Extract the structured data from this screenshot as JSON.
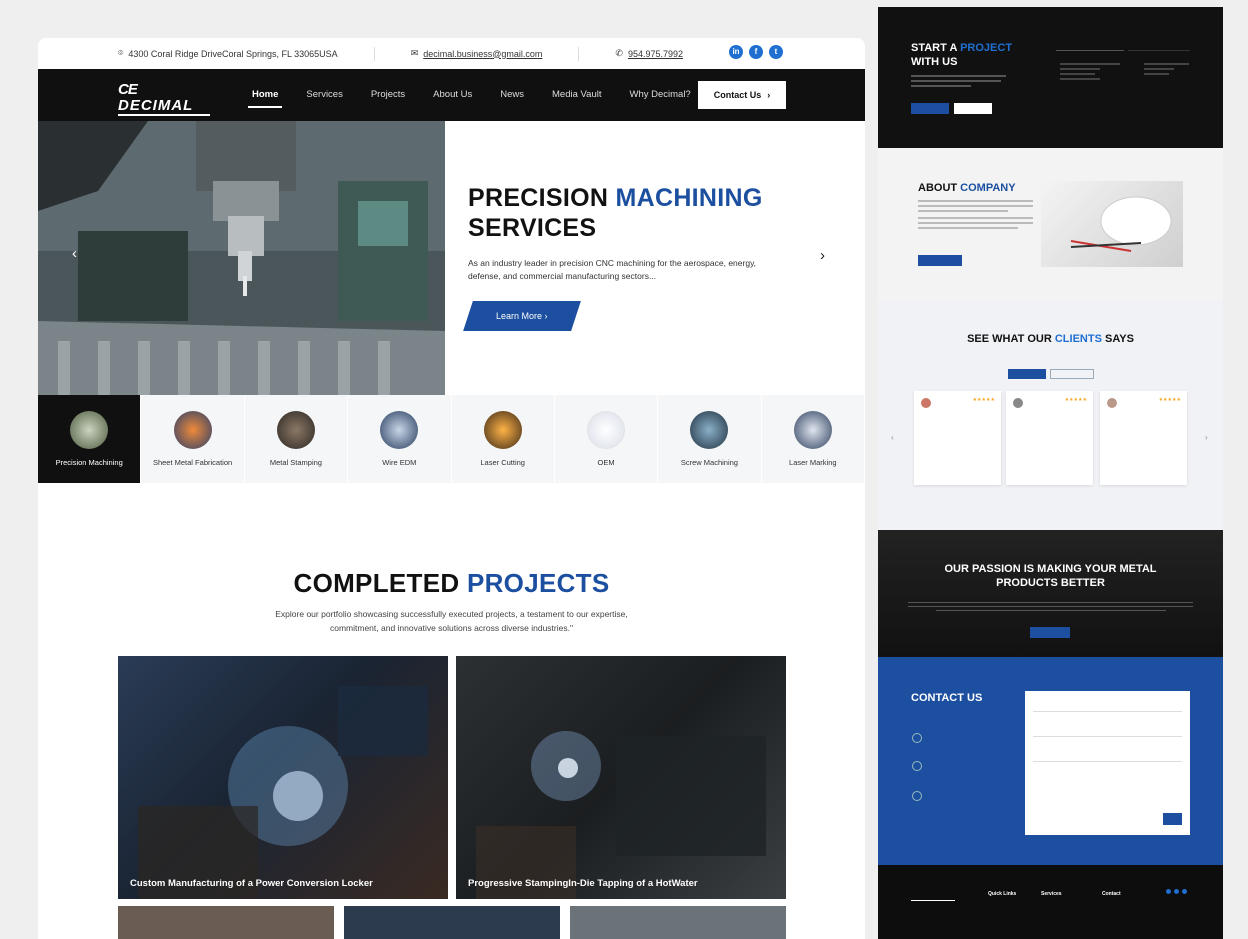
{
  "topbar": {
    "address": "4300 Coral Ridge DriveCoral Springs, FL 33065USA",
    "email": "decimal.business@gmail.com",
    "phone": "954.975.7992"
  },
  "nav": {
    "logo_text": "DECIMAL",
    "items": [
      "Home",
      "Services",
      "Projects",
      "About Us",
      "News",
      "Media Vault",
      "Why Decimal?"
    ],
    "contact_label": "Contact Us"
  },
  "hero": {
    "title_a": "PRECISION ",
    "title_b": "MACHINING",
    "title_c": "SERVICES",
    "description": "As an industry leader in precision CNC machining for the aerospace, energy, defense, and commercial manufacturing sectors...",
    "cta": "Learn More"
  },
  "services": [
    "Precision Machining",
    "Sheet Metal Fabrication",
    "Metal Stamping",
    "Wire EDM",
    "Laser Cutting",
    "OEM",
    "Screw Machining",
    "Laser Marking"
  ],
  "projects": {
    "title_a": "COMPLETED ",
    "title_b": "PROJECTS",
    "description": "Explore our portfolio showcasing successfully executed projects, a testament to our expertise, commitment, and innovative solutions across diverse industries.\"",
    "cards": [
      "Custom Manufacturing of a Power Conversion Locker",
      "Progressive StampingIn-Die Tapping of a HotWater"
    ]
  },
  "side": {
    "start_a": "START A ",
    "start_b": "PROJECT",
    "start_c": "WITH US",
    "about_a": "ABOUT ",
    "about_b": "COMPANY",
    "clients_a": "SEE WHAT OUR ",
    "clients_b": "CLIENTS",
    "clients_c": " SAYS",
    "passion": "OUR PASSION IS MAKING YOUR METAL PRODUCTS BETTER",
    "contact": "CONTACT US",
    "footer_cols": [
      "Quick Links",
      "Services",
      "Contact"
    ]
  },
  "colors": {
    "brand_blue": "#1c4fa0",
    "dark": "#101010",
    "accent_blue": "#1f6fd1"
  }
}
